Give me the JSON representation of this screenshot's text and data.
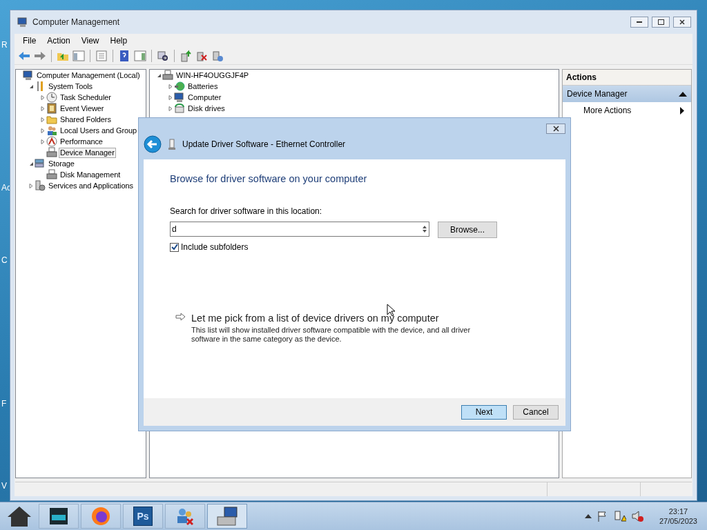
{
  "desktop_labels": [
    "R",
    "Ac",
    "C",
    "F",
    "V"
  ],
  "window": {
    "title": "Computer Management",
    "menu": [
      "File",
      "Action",
      "View",
      "Help"
    ]
  },
  "left_tree": [
    {
      "label": "Computer Management (Local)",
      "selected": false,
      "children": [
        {
          "label": "System Tools",
          "selected": false,
          "expanded": true,
          "children": [
            {
              "label": "Task Scheduler",
              "selected": false,
              "expanded": false
            },
            {
              "label": "Event Viewer",
              "selected": false,
              "expanded": false
            },
            {
              "label": "Shared Folders",
              "selected": false,
              "expanded": false
            },
            {
              "label": "Local Users and Group",
              "selected": false,
              "expanded": false
            },
            {
              "label": "Performance",
              "selected": false,
              "expanded": false
            },
            {
              "label": "Device Manager",
              "selected": true
            }
          ]
        },
        {
          "label": "Storage",
          "selected": false,
          "expanded": true,
          "children": [
            {
              "label": "Disk Management",
              "selected": false
            }
          ]
        },
        {
          "label": "Services and Applications",
          "selected": false,
          "expanded": false
        }
      ]
    }
  ],
  "device_tree": [
    {
      "label": "WIN-HF4OUGGJF4P",
      "selected": false,
      "expanded": true,
      "children": [
        {
          "label": "Batteries",
          "selected": false,
          "expanded": false
        },
        {
          "label": "Computer",
          "selected": false,
          "expanded": false
        },
        {
          "label": "Disk drives",
          "selected": false,
          "expanded": false
        }
      ]
    }
  ],
  "actions": {
    "header": "Actions",
    "section": {
      "label": "Device Manager",
      "expanded": true
    },
    "items": [
      "More Actions"
    ]
  },
  "dialog": {
    "title": "Update Driver Software - Ethernet Controller",
    "heading": "Browse for driver software on your computer",
    "location_label": "Search for driver software in this location:",
    "location_value": "d",
    "browse_button": "Browse...",
    "include_subfolders": {
      "label": "Include subfolders",
      "checked": true
    },
    "option": {
      "title": "Let me pick from a list of device drivers on my computer",
      "description": "This list will show installed driver software compatible with the device, and all driver software in the same category as the device."
    },
    "buttons": [
      {
        "label": "Next",
        "default": true
      },
      {
        "label": "Cancel",
        "default": false
      }
    ]
  },
  "taskbar": {
    "apps": [
      {
        "kind": "files",
        "active": false
      },
      {
        "kind": "browser",
        "active": false
      },
      {
        "kind": "ps",
        "label": "Ps",
        "active": false
      },
      {
        "kind": "users",
        "active": false
      },
      {
        "kind": "computer",
        "active": true
      }
    ],
    "time": "23:17",
    "date": "27/05/2023"
  }
}
